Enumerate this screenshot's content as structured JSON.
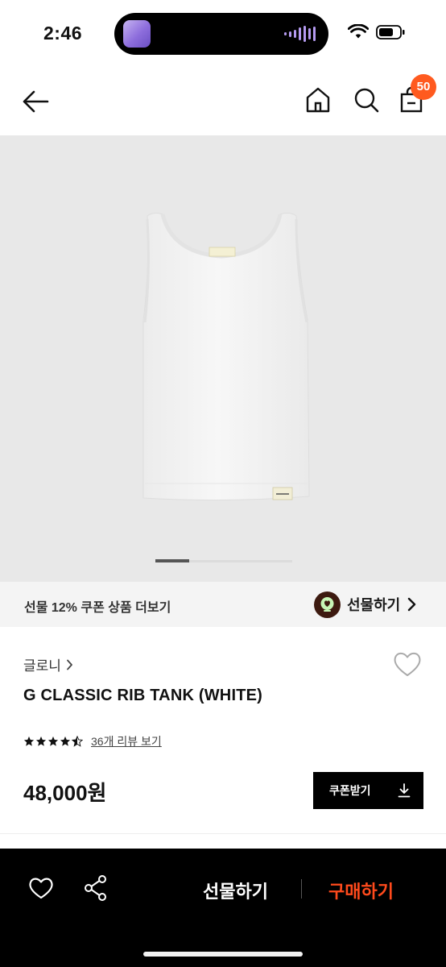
{
  "status_bar": {
    "time": "2:46",
    "icons": [
      "music-app-thumbnail-icon",
      "audio-waveform-icon",
      "wifi-icon",
      "battery-icon"
    ]
  },
  "header": {
    "icons": [
      "back-arrow-icon",
      "home-icon",
      "search-icon",
      "cart-icon"
    ],
    "cart_count": "50",
    "badge_color": "#ff5a1f"
  },
  "gallery": {
    "page_indicator": "1st image of several"
  },
  "gift_banner": {
    "text": "선물 12% 쿠폰 상품 더보기",
    "link_label": "선물하기"
  },
  "product": {
    "brand": "글로니",
    "name": "G CLASSIC RIB TANK (WHITE)",
    "rating": 4.5,
    "review_link": "36개 리뷰 보기",
    "price": "48,000원",
    "coupon_button": "쿠폰받기"
  },
  "bottom_bar": {
    "gift_label": "선물하기",
    "buy_label": "구매하기",
    "buy_color": "#ff4a1c"
  }
}
